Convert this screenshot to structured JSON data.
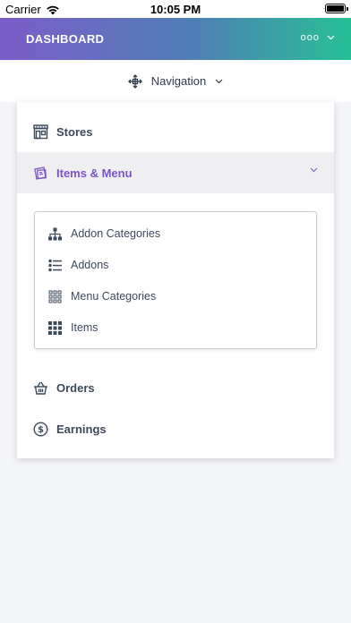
{
  "status_bar": {
    "carrier": "Carrier",
    "time": "10:05 PM"
  },
  "header": {
    "title": "DASHBOARD",
    "user_menu": "ooo"
  },
  "nav": {
    "label": "Navigation"
  },
  "menu": {
    "stores": "Stores",
    "items_menu": "Items & Menu",
    "orders": "Orders",
    "earnings": "Earnings"
  },
  "submenu": {
    "addon_categories": "Addon Categories",
    "addons": "Addons",
    "menu_categories": "Menu Categories",
    "items": "Items"
  },
  "colors": {
    "accent": "#7d52c6",
    "header_gradient_start": "#7c5cc9",
    "header_gradient_end": "#27c095",
    "text": "#3d4a5c"
  }
}
